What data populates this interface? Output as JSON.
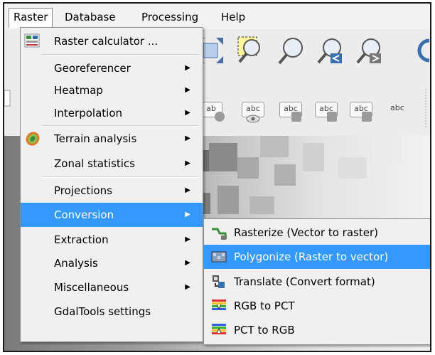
{
  "menubar": {
    "items": [
      "Raster",
      "Database",
      "Processing",
      "Help"
    ]
  },
  "raster_menu": {
    "items": [
      {
        "label": "Raster calculator ...",
        "submenu": false,
        "icon": "raster-calculator-icon"
      },
      {
        "label": "Georeferencer",
        "submenu": true
      },
      {
        "label": "Heatmap",
        "submenu": true
      },
      {
        "label": "Interpolation",
        "submenu": true
      },
      {
        "label": "Terrain analysis",
        "submenu": true,
        "icon": "terrain-analysis-icon"
      },
      {
        "label": "Zonal statistics",
        "submenu": true
      },
      {
        "label": "Projections",
        "submenu": true
      },
      {
        "label": "Conversion",
        "submenu": true,
        "highlighted": true
      },
      {
        "label": "Extraction",
        "submenu": true
      },
      {
        "label": "Analysis",
        "submenu": true
      },
      {
        "label": "Miscellaneous",
        "submenu": true
      },
      {
        "label": "GdalTools settings",
        "submenu": false
      }
    ]
  },
  "conversion_submenu": {
    "items": [
      {
        "label": "Rasterize (Vector to raster)",
        "icon": "rasterize-icon"
      },
      {
        "label": "Polygonize (Raster to vector)",
        "icon": "polygonize-icon",
        "highlighted": true
      },
      {
        "label": "Translate (Convert format)",
        "icon": "translate-icon"
      },
      {
        "label": "RGB to PCT",
        "icon": "rgb-to-pct-icon"
      },
      {
        "label": "PCT to RGB",
        "icon": "pct-to-rgb-icon"
      }
    ]
  },
  "toolbar_labels": {
    "label1": "ab",
    "label2": "abc",
    "label3": "abc",
    "label4": "abc",
    "label5": "abc",
    "label6": "abc"
  },
  "colors": {
    "highlight": "#3399ff",
    "menu_bg": "#f0f0f0"
  }
}
